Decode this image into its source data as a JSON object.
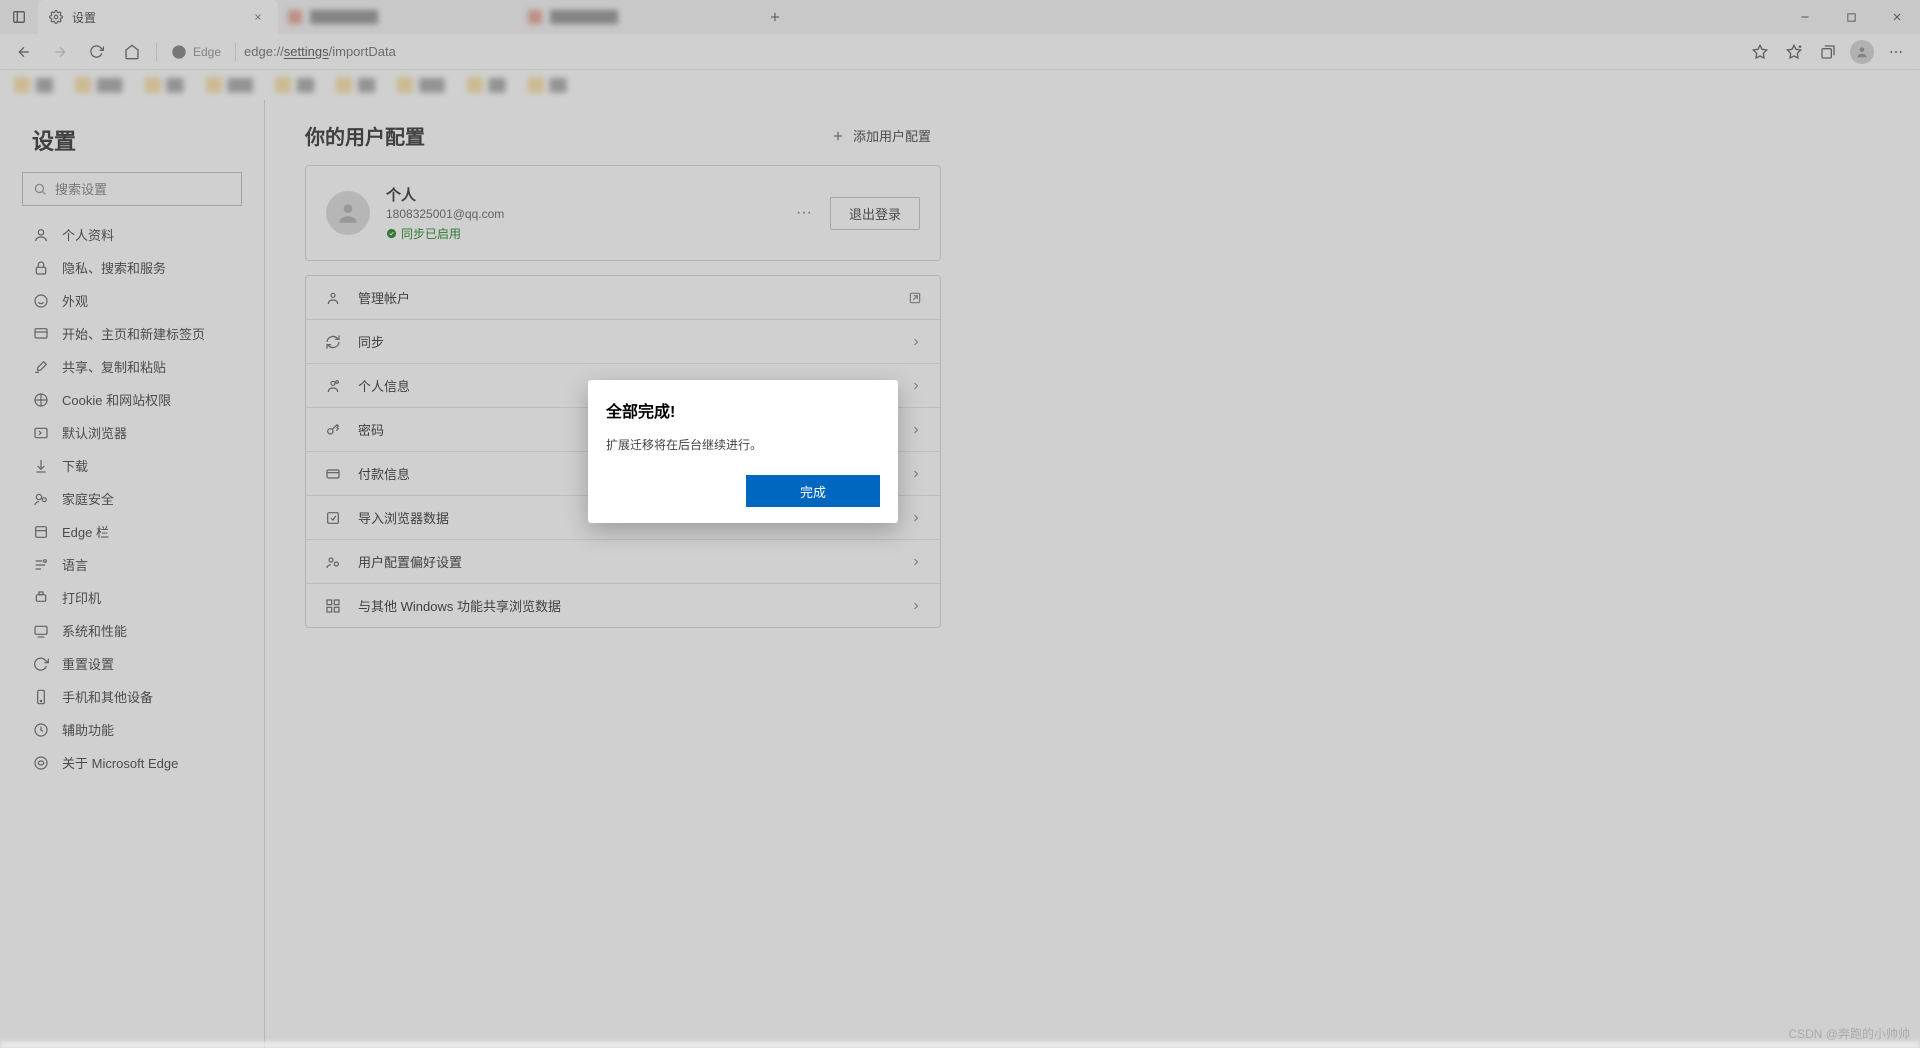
{
  "window": {
    "tab_title": "设置",
    "minimize": "—",
    "maximize": "❐",
    "close": "✕"
  },
  "addressbar": {
    "brand": "Edge",
    "url_prefix": "edge://",
    "url_mid": "settings",
    "url_suffix": "/importData"
  },
  "sidebar": {
    "heading": "设置",
    "search_placeholder": "搜索设置",
    "items": [
      {
        "label": "个人资料"
      },
      {
        "label": "隐私、搜索和服务"
      },
      {
        "label": "外观"
      },
      {
        "label": "开始、主页和新建标签页"
      },
      {
        "label": "共享、复制和粘贴"
      },
      {
        "label": "Cookie 和网站权限"
      },
      {
        "label": "默认浏览器"
      },
      {
        "label": "下载"
      },
      {
        "label": "家庭安全"
      },
      {
        "label": "Edge 栏"
      },
      {
        "label": "语言"
      },
      {
        "label": "打印机"
      },
      {
        "label": "系统和性能"
      },
      {
        "label": "重置设置"
      },
      {
        "label": "手机和其他设备"
      },
      {
        "label": "辅助功能"
      },
      {
        "label": "关于 Microsoft Edge"
      }
    ]
  },
  "main": {
    "heading": "你的用户配置",
    "add_profile": "添加用户配置",
    "profile": {
      "name": "个人",
      "email": "1808325001@qq.com",
      "sync_status": "同步已启用",
      "more": "···",
      "signout": "退出登录"
    },
    "rows": [
      {
        "label": "管理帐户",
        "ext": true
      },
      {
        "label": "同步"
      },
      {
        "label": "个人信息"
      },
      {
        "label": "密码"
      },
      {
        "label": "付款信息"
      },
      {
        "label": "导入浏览器数据"
      },
      {
        "label": "用户配置偏好设置"
      },
      {
        "label": "与其他 Windows 功能共享浏览数据"
      }
    ]
  },
  "modal": {
    "title": "全部完成!",
    "body": "扩展迁移将在后台继续进行。",
    "done": "完成"
  },
  "watermark": "CSDN @奔跑的小帅帅"
}
